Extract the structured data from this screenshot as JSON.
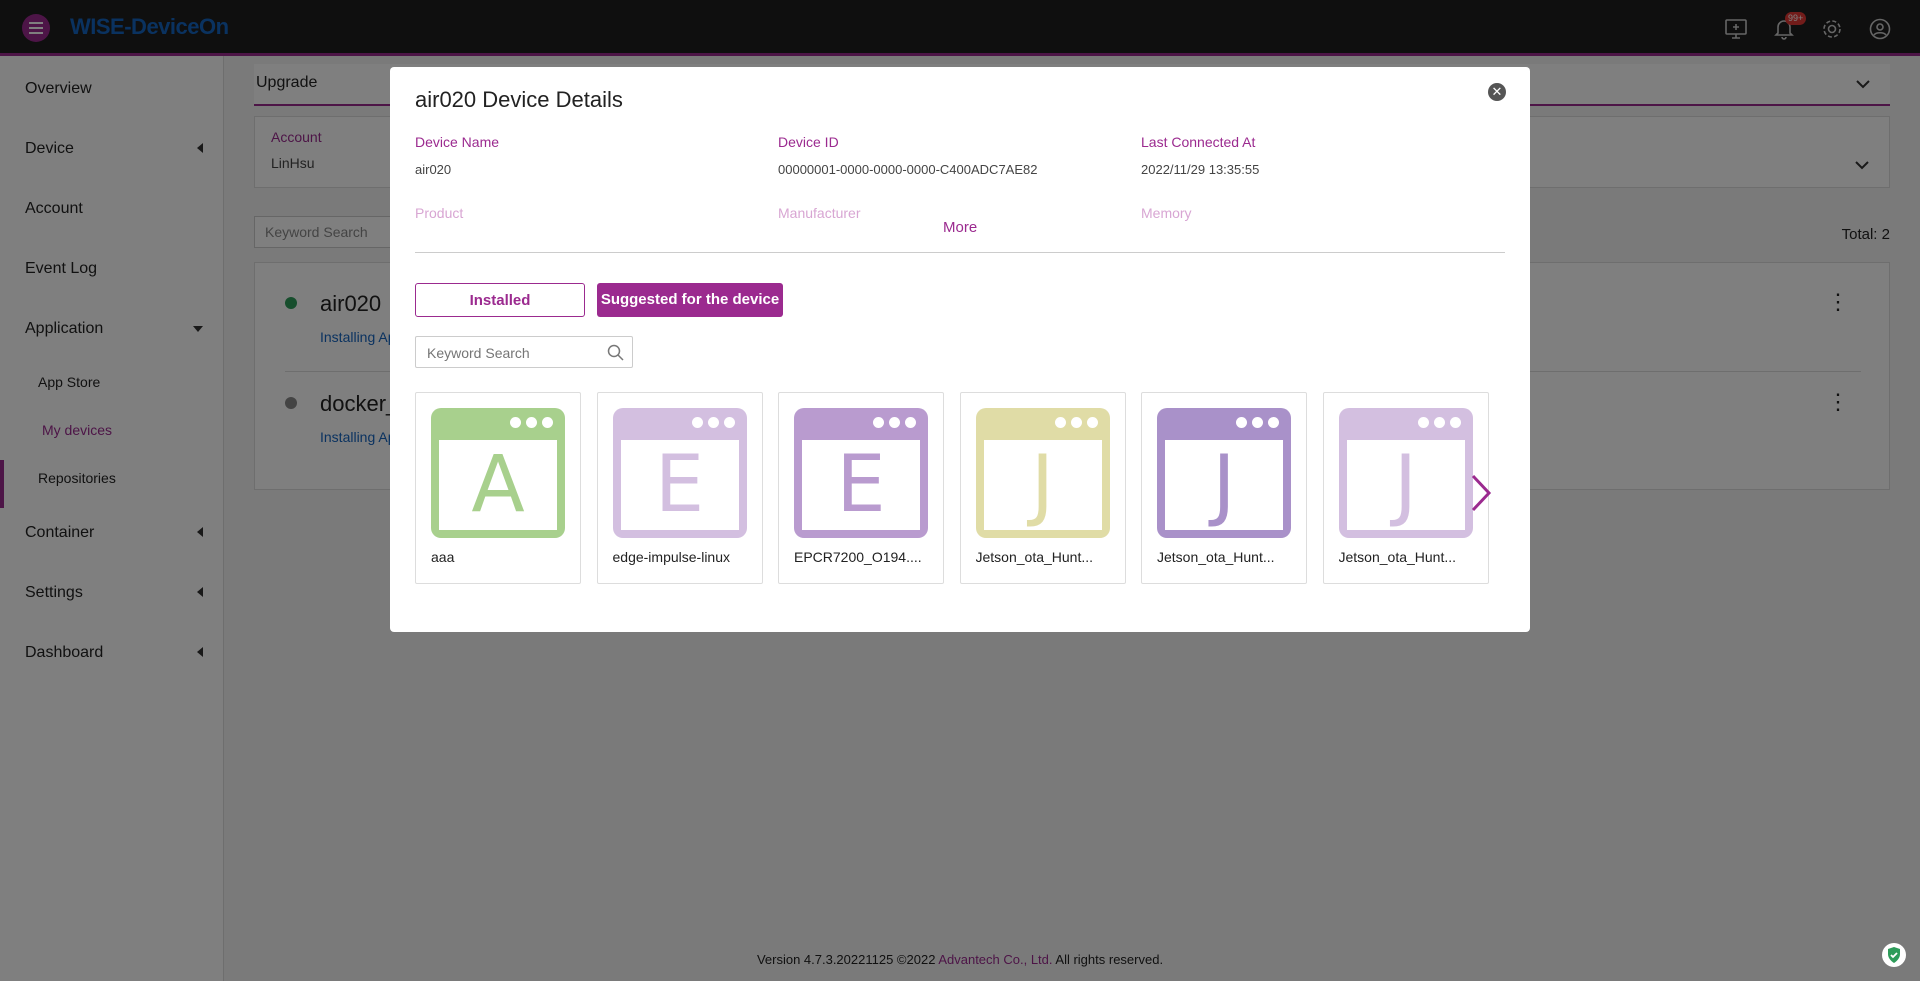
{
  "app": {
    "brand": "WISE-DeviceOn",
    "notification_count": "99+"
  },
  "sidebar": {
    "items": [
      {
        "label": "Overview"
      },
      {
        "label": "Device"
      },
      {
        "label": "Account"
      },
      {
        "label": "Event Log"
      },
      {
        "label": "Application"
      },
      {
        "label": "App Store"
      },
      {
        "label": "My devices"
      },
      {
        "label": "Repositories"
      },
      {
        "label": "Container"
      },
      {
        "label": "Settings"
      },
      {
        "label": "Dashboard"
      }
    ]
  },
  "background": {
    "section_title": "Upgrade",
    "account_label": "Account",
    "account_value": "LinHsu",
    "search_placeholder": "Keyword Search",
    "total": "Total: 2",
    "devices": [
      {
        "name": "air020",
        "status_text": "Installing Ap"
      },
      {
        "name": "docker_",
        "status_text": "Installing Ap"
      }
    ]
  },
  "modal": {
    "title": "air020 Device Details",
    "fields": {
      "device_name_label": "Device Name",
      "device_name_value": "air020",
      "device_id_label": "Device ID",
      "device_id_value": "00000001-0000-0000-0000-C400ADC7AE82",
      "last_connected_label": "Last Connected At",
      "last_connected_value": "2022/11/29 13:35:55",
      "product_label": "Product",
      "manufacturer_label": "Manufacturer",
      "memory_label": "Memory"
    },
    "more_label": "More",
    "tabs": {
      "installed": "Installed",
      "suggested": "Suggested for the device"
    },
    "search_placeholder": "Keyword Search",
    "apps": [
      {
        "letter": "A",
        "name": "aaa",
        "color": "#a8d08d"
      },
      {
        "letter": "E",
        "name": "edge-impulse-linux",
        "color": "#d3bfe0"
      },
      {
        "letter": "E",
        "name": "EPCR7200_O194....",
        "color": "#b99bcf"
      },
      {
        "letter": "J",
        "name": "Jetson_ota_Hunt...",
        "color": "#e0dca6"
      },
      {
        "letter": "J",
        "name": "Jetson_ota_Hunt...",
        "color": "#a991c9"
      },
      {
        "letter": "J",
        "name": "Jetson_ota_Hunt...",
        "color": "#d3bfe0"
      }
    ]
  },
  "footer": {
    "prefix": "Version 4.7.3.20221125 ©2022 ",
    "company": "Advantech Co., Ltd.",
    "suffix": " All rights reserved."
  }
}
